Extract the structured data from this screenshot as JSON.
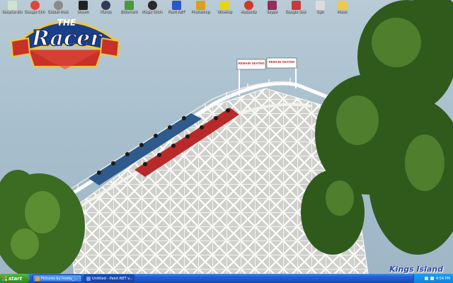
{
  "desktop_icons": [
    {
      "label": "Recycle Bin",
      "color": "#cfe3cf"
    },
    {
      "label": "Google Chrome",
      "color": "#e0453a"
    },
    {
      "label": "Global Modern Warfare",
      "color": "#8a8a8a"
    },
    {
      "label": "Steam",
      "color": "#222222"
    },
    {
      "label": "iTunes",
      "color": "#333a55"
    },
    {
      "label": "Bittorrent",
      "color": "#4a9a3a"
    },
    {
      "label": "Magic Orchestra",
      "color": "#2a2a2a"
    },
    {
      "label": "Paint.NET",
      "color": "#2a58c4"
    },
    {
      "label": "Photoshop",
      "color": "#d8a020"
    },
    {
      "label": "WinAmp",
      "color": "#e8d21c"
    },
    {
      "label": "Audacity",
      "color": "#d03a2a"
    },
    {
      "label": "Skype",
      "color": "#9a2a5a"
    },
    {
      "label": "Google Sketchup",
      "color": "#c83a3a"
    },
    {
      "label": "Ugh",
      "color": "#dcdcdc"
    },
    {
      "label": "Music",
      "color": "#f2c84a"
    }
  ],
  "logo": {
    "small": "THE",
    "main": "Racer"
  },
  "signs": [
    "REMAIN SEATED",
    "REMAIN SEATED"
  ],
  "watermark": "Kings Island",
  "taskbar": {
    "start_label": "start",
    "tasks": [
      {
        "label": "Pictures by hooky_...",
        "active": false
      },
      {
        "label": "Untitled - Paint.NET v...",
        "active": true
      }
    ],
    "clock": "4:54 PM"
  }
}
